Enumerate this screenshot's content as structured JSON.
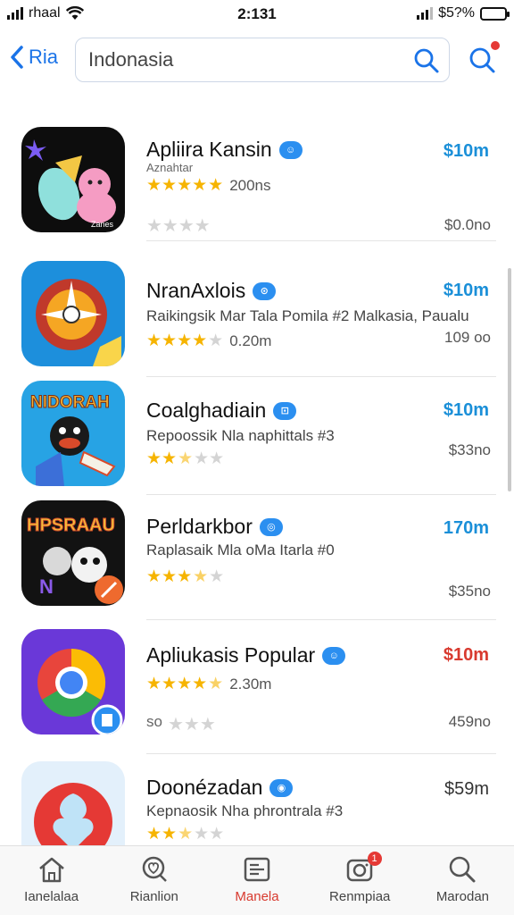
{
  "status": {
    "carrier": "rhaal",
    "time": "2:131",
    "battery": "$5?%"
  },
  "nav": {
    "back_label": "Ria",
    "search_value": "Indonasia"
  },
  "apps": [
    {
      "name": "Apliira Kansin",
      "subtitle": "Aznahtar",
      "rating": 4.5,
      "rating_text": "200ns",
      "price": "$10m",
      "price2": "$0.0no",
      "extra": ""
    },
    {
      "name": "NranAxlois",
      "subtitle": "Raikingsik Mar Tala Pomila #2 Malkasia, Paualu",
      "rating": 4,
      "rating_text": "0.20m",
      "price": "$10m",
      "price2": "109 oo",
      "extra": ""
    },
    {
      "name": "Coalghadiain",
      "subtitle": "Repoossik Nla naphittals #3",
      "rating": 2.5,
      "rating_text": "",
      "price": "$10m",
      "price2": "$33no",
      "extra": ""
    },
    {
      "name": "Perldarkbor",
      "subtitle": "Raplasaik Mla oMa Itarla #0",
      "rating": 3.5,
      "rating_text": "",
      "price": "170m",
      "price2": "$35no",
      "extra": ""
    },
    {
      "name": "Apliukasis Popular",
      "subtitle": "",
      "rating": 4.5,
      "rating_text": "2.30m",
      "price": "$10m",
      "price2": "459no",
      "extra": "so"
    },
    {
      "name": "Doonézadan",
      "subtitle": "Kepnaosik Nha phrontrala #3",
      "rating": 2.5,
      "rating_text": "",
      "price": "$59m",
      "price2": "",
      "extra": ""
    }
  ],
  "tabs": [
    {
      "label": "Ianelalaa",
      "icon": "home-icon"
    },
    {
      "label": "Rianlion",
      "icon": "heart-icon"
    },
    {
      "label": "Manela",
      "icon": "list-icon"
    },
    {
      "label": "Renmpiaa",
      "icon": "camera-icon",
      "badge": "1"
    },
    {
      "label": "Marodan",
      "icon": "search-icon"
    }
  ],
  "colors": {
    "accent": "#1a73e8",
    "price_blue": "#1a8fd8",
    "price_red": "#d83a2f",
    "star": "#f6b400",
    "active_tab": "#d83a2f"
  }
}
